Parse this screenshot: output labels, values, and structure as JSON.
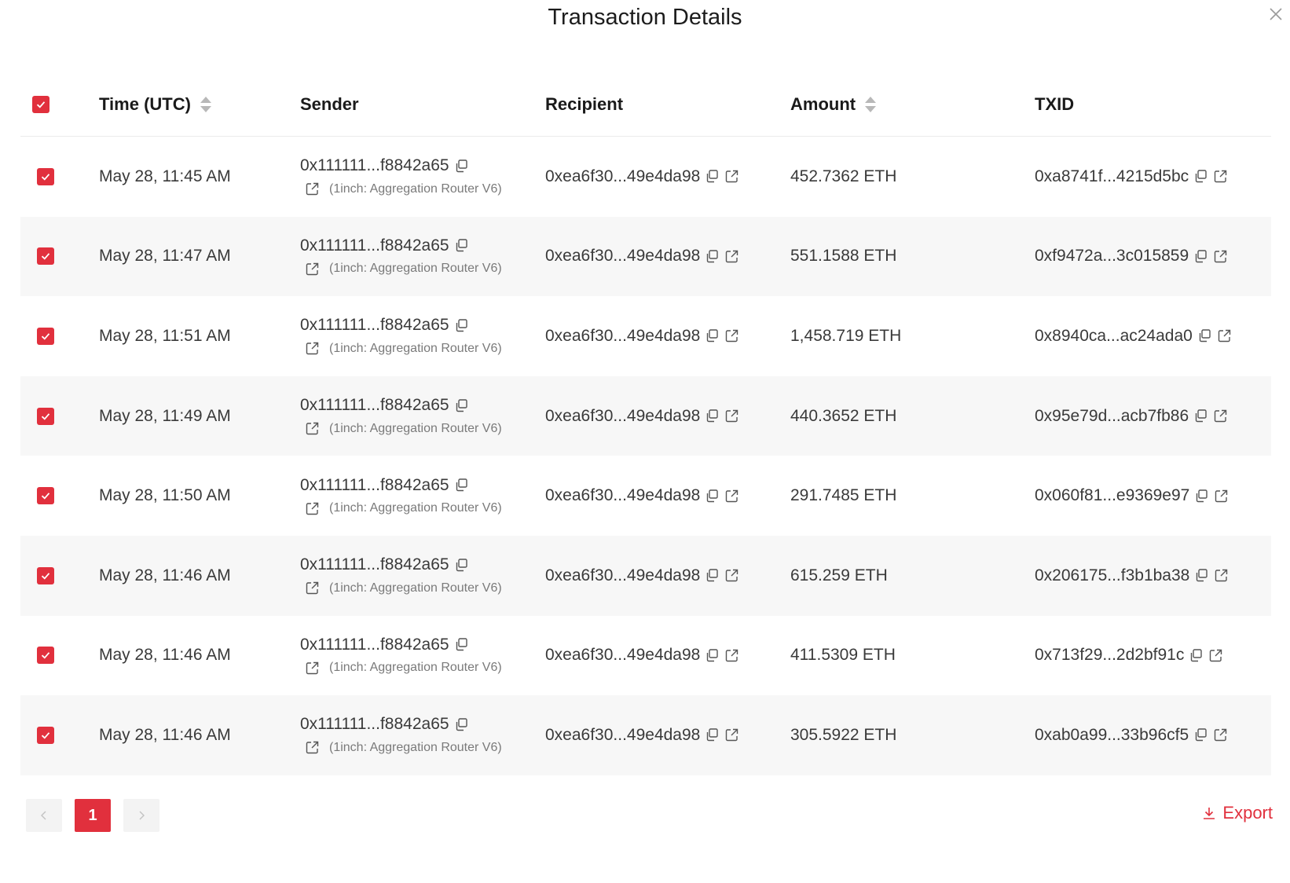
{
  "modal": {
    "title": "Transaction Details"
  },
  "colors": {
    "accent": "#e1303d"
  },
  "table": {
    "columns": [
      {
        "key": "time",
        "label": "Time (UTC)",
        "sortable": true
      },
      {
        "key": "sender",
        "label": "Sender",
        "sortable": false
      },
      {
        "key": "recipient",
        "label": "Recipient",
        "sortable": false
      },
      {
        "key": "amount",
        "label": "Amount",
        "sortable": true
      },
      {
        "key": "txid",
        "label": "TXID",
        "sortable": false
      }
    ],
    "rows": [
      {
        "checked": true,
        "time": "May 28, 11:45 AM",
        "sender": "0x111111...f8842a65",
        "sender_tag": "(1inch: Aggregation Router V6)",
        "recipient": "0xea6f30...49e4da98",
        "amount": "452.7362 ETH",
        "txid": "0xa8741f...4215d5bc"
      },
      {
        "checked": true,
        "time": "May 28, 11:47 AM",
        "sender": "0x111111...f8842a65",
        "sender_tag": "(1inch: Aggregation Router V6)",
        "recipient": "0xea6f30...49e4da98",
        "amount": "551.1588 ETH",
        "txid": "0xf9472a...3c015859"
      },
      {
        "checked": true,
        "time": "May 28, 11:51 AM",
        "sender": "0x111111...f8842a65",
        "sender_tag": "(1inch: Aggregation Router V6)",
        "recipient": "0xea6f30...49e4da98",
        "amount": "1,458.719 ETH",
        "txid": "0x8940ca...ac24ada0"
      },
      {
        "checked": true,
        "time": "May 28, 11:49 AM",
        "sender": "0x111111...f8842a65",
        "sender_tag": "(1inch: Aggregation Router V6)",
        "recipient": "0xea6f30...49e4da98",
        "amount": "440.3652 ETH",
        "txid": "0x95e79d...acb7fb86"
      },
      {
        "checked": true,
        "time": "May 28, 11:50 AM",
        "sender": "0x111111...f8842a65",
        "sender_tag": "(1inch: Aggregation Router V6)",
        "recipient": "0xea6f30...49e4da98",
        "amount": "291.7485 ETH",
        "txid": "0x060f81...e9369e97"
      },
      {
        "checked": true,
        "time": "May 28, 11:46 AM",
        "sender": "0x111111...f8842a65",
        "sender_tag": "(1inch: Aggregation Router V6)",
        "recipient": "0xea6f30...49e4da98",
        "amount": "615.259 ETH",
        "txid": "0x206175...f3b1ba38"
      },
      {
        "checked": true,
        "time": "May 28, 11:46 AM",
        "sender": "0x111111...f8842a65",
        "sender_tag": "(1inch: Aggregation Router V6)",
        "recipient": "0xea6f30...49e4da98",
        "amount": "411.5309 ETH",
        "txid": "0x713f29...2d2bf91c"
      },
      {
        "checked": true,
        "time": "May 28, 11:46 AM",
        "sender": "0x111111...f8842a65",
        "sender_tag": "(1inch: Aggregation Router V6)",
        "recipient": "0xea6f30...49e4da98",
        "amount": "305.5922 ETH",
        "txid": "0xab0a99...33b96cf5"
      }
    ]
  },
  "pagination": {
    "current_page": "1"
  },
  "footer": {
    "export_label": "Export"
  }
}
